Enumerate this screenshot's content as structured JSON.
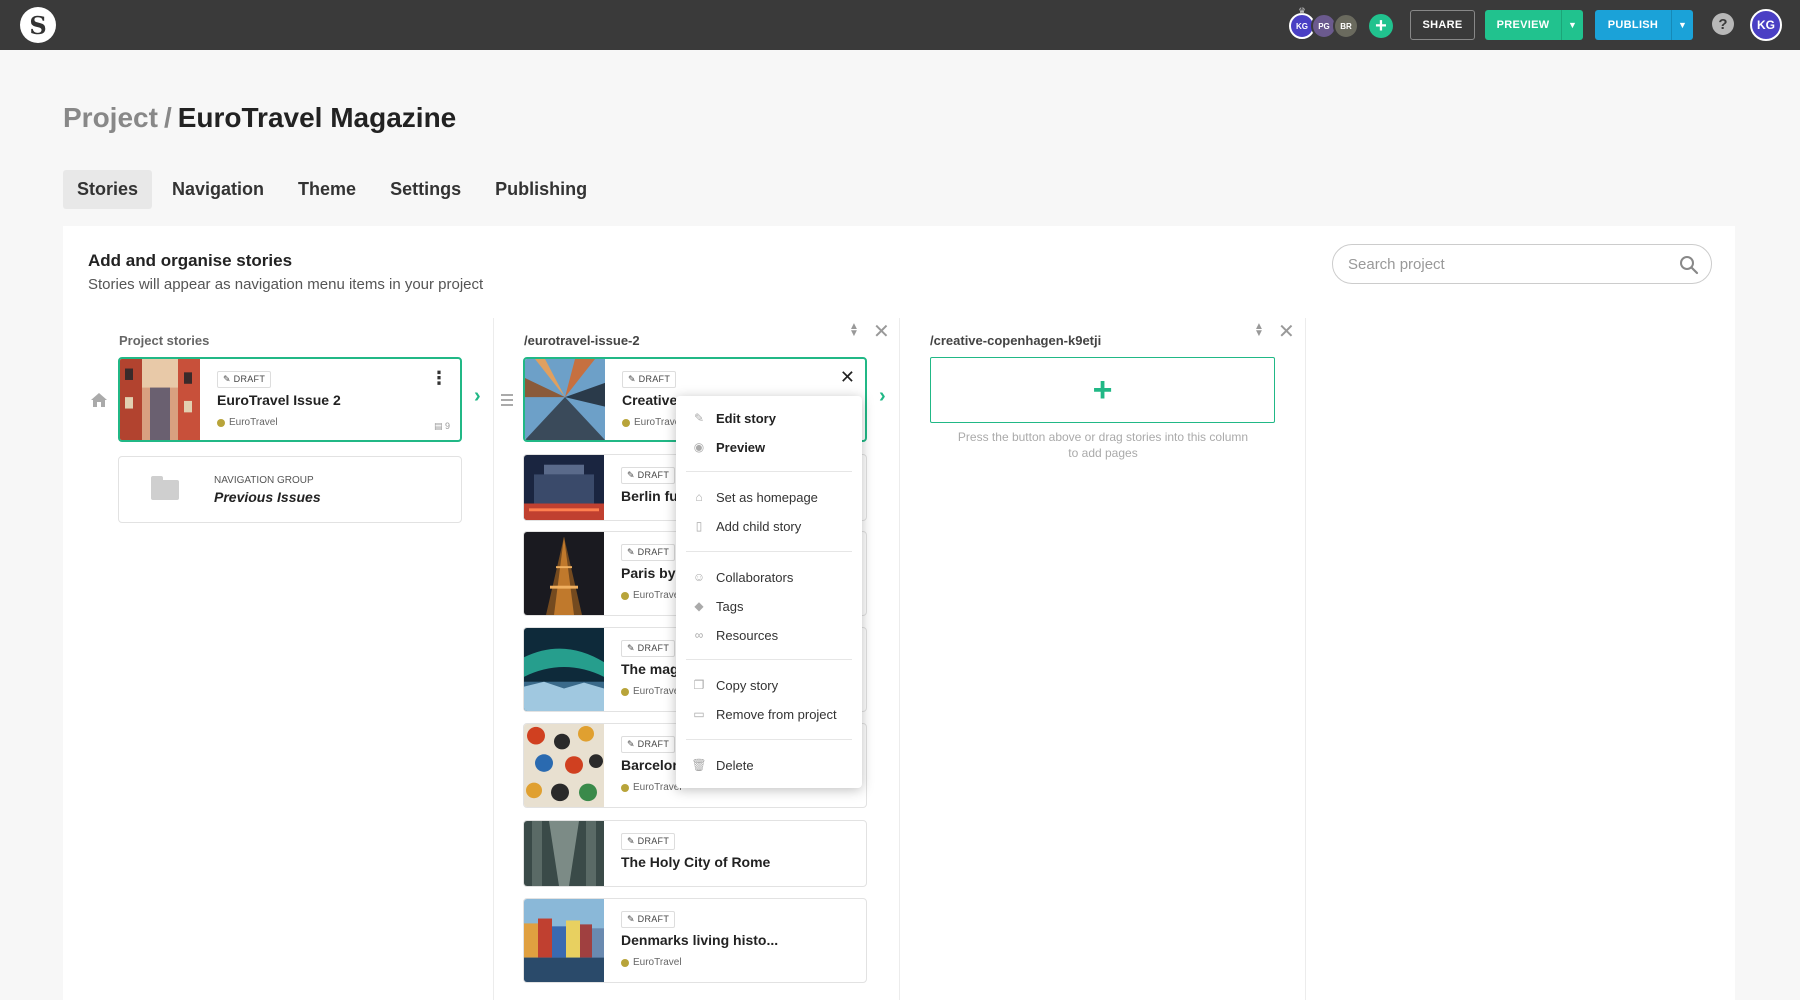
{
  "topbar": {
    "logo": "S",
    "collaborators": [
      {
        "initials": "KG",
        "color": "#4a3fc4"
      },
      {
        "initials": "PG",
        "color": "#6b5a8e"
      },
      {
        "initials": "BR",
        "color": "#6a6a5e"
      }
    ],
    "share_label": "SHARE",
    "preview_label": "PREVIEW",
    "publish_label": "PUBLISH",
    "help_label": "?",
    "user_initials": "KG",
    "colors": {
      "preview": "#21c28e",
      "publish": "#1ba2d8",
      "accent": "#21b886"
    }
  },
  "breadcrumb": {
    "project": "Project",
    "separator": "/",
    "current": "EuroTravel Magazine"
  },
  "tabs": [
    "Stories",
    "Navigation",
    "Theme",
    "Settings",
    "Publishing"
  ],
  "panel": {
    "title": "Add and organise stories",
    "subtitle": "Stories will appear as navigation menu items in your project",
    "search_placeholder": "Search project"
  },
  "columns": {
    "project": {
      "header": "Project stories",
      "story": {
        "status": "DRAFT",
        "title": "EuroTravel Issue 2",
        "tag": "EuroTravel",
        "count": "9"
      },
      "group": {
        "label": "NAVIGATION GROUP",
        "name": "Previous Issues"
      }
    },
    "issue": {
      "header": "/eurotravel-issue-2",
      "stories": [
        {
          "status": "DRAFT",
          "title": "Creative",
          "tag": "EuroTravel"
        },
        {
          "status": "DRAFT",
          "title": "Berlin fu",
          "tag": ""
        },
        {
          "status": "DRAFT",
          "title": "Paris by",
          "tag": "EuroTravel"
        },
        {
          "status": "DRAFT",
          "title": "The mag",
          "tag": "EuroTravel"
        },
        {
          "status": "DRAFT",
          "title": "Barcelon",
          "tag": "EuroTravel"
        },
        {
          "status": "DRAFT",
          "title": "The Holy City of Rome",
          "tag": ""
        },
        {
          "status": "DRAFT",
          "title": "Denmarks living histo...",
          "tag": "EuroTravel"
        }
      ]
    },
    "copenhagen": {
      "header": "/creative-copenhagen-k9etji",
      "add_label": "+",
      "hint": "Press the button above or drag stories into this column to add pages"
    }
  },
  "context_menu": {
    "items": [
      {
        "label": "Edit story",
        "icon": "pencil-icon"
      },
      {
        "label": "Preview",
        "icon": "eye-icon"
      },
      {
        "label": "Set as homepage",
        "icon": "home-icon"
      },
      {
        "label": "Add child story",
        "icon": "file-icon"
      },
      {
        "label": "Collaborators",
        "icon": "users-icon"
      },
      {
        "label": "Tags",
        "icon": "tag-icon"
      },
      {
        "label": "Resources",
        "icon": "link-icon"
      },
      {
        "label": "Copy story",
        "icon": "copy-icon"
      },
      {
        "label": "Remove from project",
        "icon": "remove-file-icon"
      },
      {
        "label": "Delete",
        "icon": "trash-icon"
      }
    ]
  }
}
